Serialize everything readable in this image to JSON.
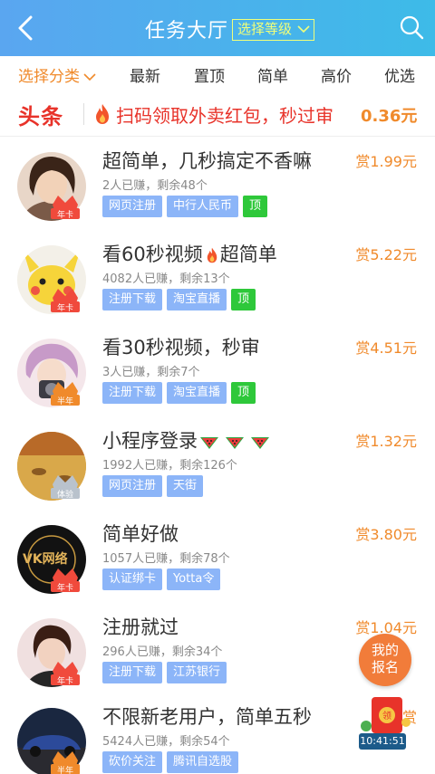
{
  "header": {
    "title": "任务大厅",
    "level_select": "选择等级"
  },
  "tabs": [
    {
      "label": "选择分类"
    },
    {
      "label": "最新"
    },
    {
      "label": "置顶"
    },
    {
      "label": "简单"
    },
    {
      "label": "高价"
    },
    {
      "label": "优选"
    }
  ],
  "news": {
    "tag": "头条",
    "text": "扫码领取外卖红包，秒过审",
    "amount": "0.36元"
  },
  "tasks": [
    {
      "title": "超简单，几秒搞定不香嘛",
      "meta": "2人已赚，剩余48个",
      "reward": "赏1.99元",
      "badge": "年卡",
      "tags": [
        "网页注册",
        "中行人民币",
        "顶"
      ]
    },
    {
      "title": "看60秒视频",
      "title2": "超简单",
      "meta": "4082人已赚，剩余13个",
      "reward": "赏5.22元",
      "badge": "年卡",
      "tags": [
        "注册下载",
        "淘宝直播",
        "顶"
      ]
    },
    {
      "title": "看30秒视频，秒审",
      "meta": "3人已赚，剩余7个",
      "reward": "赏4.51元",
      "badge": "半年",
      "tags": [
        "注册下载",
        "淘宝直播",
        "顶"
      ]
    },
    {
      "title": "小程序登录",
      "meta": "1992人已赚，剩余126个",
      "reward": "赏1.32元",
      "badge": "体验",
      "tags": [
        "网页注册",
        "天街"
      ]
    },
    {
      "title": "简单好做",
      "meta": "1057人已赚，剩余78个",
      "reward": "赏3.80元",
      "badge": "年卡",
      "tags": [
        "认证绑卡",
        "Yotta令"
      ]
    },
    {
      "title": "注册就过",
      "meta": "296人已赚，剩余34个",
      "reward": "赏1.04元",
      "badge": "年卡",
      "tags": [
        "注册下载",
        "江苏银行"
      ]
    },
    {
      "title": "不限新老用户，简单五秒",
      "meta": "5424人已赚，剩余54个",
      "reward": "赏",
      "badge": "半年",
      "tags": [
        "砍价关注",
        "腾讯自选股"
      ]
    }
  ],
  "float": {
    "signup_line1": "我的",
    "signup_line2": "报名",
    "red_label": "领",
    "timer": "10:41:51"
  },
  "colors": {
    "header": "#4aa9ee",
    "accent": "#f08a2b",
    "headline": "#e8332a",
    "tag": "#8cb5f8",
    "top_tag": "#2ec83a"
  }
}
